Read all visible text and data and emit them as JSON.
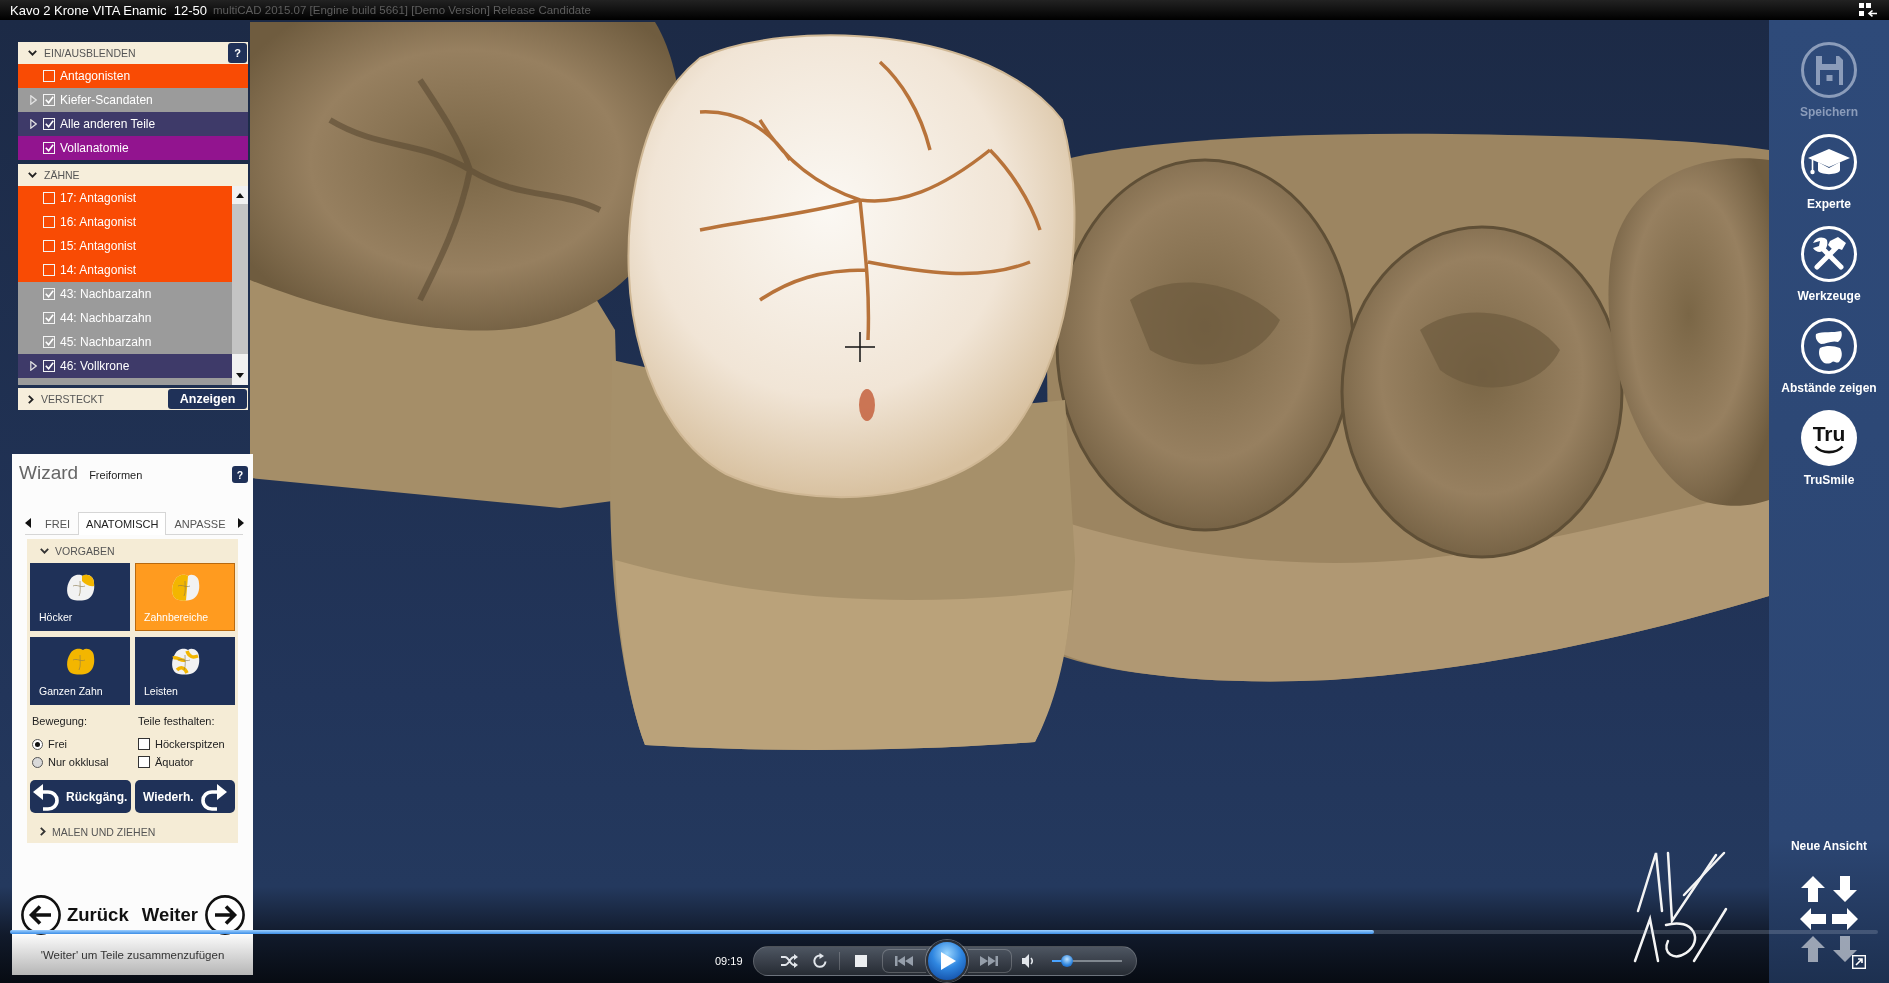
{
  "title_bar": {
    "title": "Kavo 2 Krone VITA Enamic  12-50",
    "caption_behind": "multiCAD 2015.07 [Engine build 5661] [Demo Version] Release Candidate"
  },
  "visibility_panel": {
    "header": "EIN/AUSBLENDEN",
    "expanded": true,
    "help": "?",
    "items": [
      {
        "label": "Antagonisten",
        "checked": false,
        "expandable": false,
        "color": "#f94b04"
      },
      {
        "label": "Kiefer-Scandaten",
        "checked": true,
        "expandable": true,
        "color": "#9b9b9b"
      },
      {
        "label": "Alle anderen Teile",
        "checked": true,
        "expandable": true,
        "color": "#3e3a69"
      },
      {
        "label": "Vollanatomie",
        "checked": true,
        "expandable": false,
        "color": "#92148f"
      }
    ]
  },
  "teeth_section": {
    "header": "ZÄHNE",
    "expanded": true,
    "items": [
      {
        "label": "17: Antagonist",
        "checked": false,
        "expandable": false,
        "color": "#f94b04"
      },
      {
        "label": "16: Antagonist",
        "checked": false,
        "expandable": false,
        "color": "#f94b04"
      },
      {
        "label": "15: Antagonist",
        "checked": false,
        "expandable": false,
        "color": "#f94b04"
      },
      {
        "label": "14: Antagonist",
        "checked": false,
        "expandable": false,
        "color": "#f94b04"
      },
      {
        "label": "43: Nachbarzahn",
        "checked": true,
        "expandable": false,
        "color": "#9b9b9b"
      },
      {
        "label": "44: Nachbarzahn",
        "checked": true,
        "expandable": false,
        "color": "#9b9b9b"
      },
      {
        "label": "45: Nachbarzahn",
        "checked": true,
        "expandable": false,
        "color": "#9b9b9b"
      },
      {
        "label": "46: Vollkrone",
        "checked": true,
        "expandable": true,
        "color": "#3e3a69"
      }
    ]
  },
  "hidden_section": {
    "header": "VERSTECKT",
    "expanded": false,
    "button": "Anzeigen"
  },
  "wizard": {
    "title": "Wizard",
    "subtitle": "Freiformen",
    "help": "?",
    "tabs": [
      {
        "label": "FREI",
        "selected": false
      },
      {
        "label": "ANATOMISCH",
        "selected": true
      },
      {
        "label": "ANPASSE",
        "selected": false
      }
    ],
    "presets": {
      "header": "VORGABEN",
      "expanded": true,
      "tiles": [
        {
          "label": "Höcker",
          "kind": "cusp",
          "selected": false
        },
        {
          "label": "Zahnbereiche",
          "kind": "region",
          "selected": true
        },
        {
          "label": "Ganzen Zahn",
          "kind": "whole",
          "selected": false
        },
        {
          "label": "Leisten",
          "kind": "ridge",
          "selected": false
        }
      ]
    },
    "movement": {
      "label": "Bewegung:",
      "options": [
        {
          "label": "Frei",
          "selected": true
        },
        {
          "label": "Nur okklusal",
          "selected": false
        }
      ]
    },
    "hold_parts": {
      "label": "Teile festhalten:",
      "options": [
        {
          "label": "Höckerspitzen",
          "checked": false
        },
        {
          "label": "Äquator",
          "checked": false
        }
      ]
    },
    "undo": "Rückgäng.",
    "redo": "Wiederh.",
    "painting": {
      "header": "MALEN UND ZIEHEN",
      "expanded": false
    },
    "back": "Zurück",
    "next": "Weiter",
    "hint": "'Weiter' um Teile zusammenzufügen"
  },
  "sidebar": {
    "items": [
      {
        "label": "Speichern",
        "kind": "save",
        "disabled": true
      },
      {
        "label": "Experte",
        "kind": "expert",
        "disabled": false
      },
      {
        "label": "Werkzeuge",
        "kind": "tools",
        "disabled": false
      },
      {
        "label": "Abstände zeigen",
        "kind": "distances",
        "disabled": false
      },
      {
        "label": "TruSmile",
        "kind": "smile",
        "disabled": false,
        "icon_text": "Tru"
      }
    ],
    "view_label": "Neue Ansicht"
  },
  "player": {
    "time": "09:19",
    "progress": {
      "level": 0.73
    },
    "playing": false,
    "volume": {
      "level": 0.22
    }
  }
}
